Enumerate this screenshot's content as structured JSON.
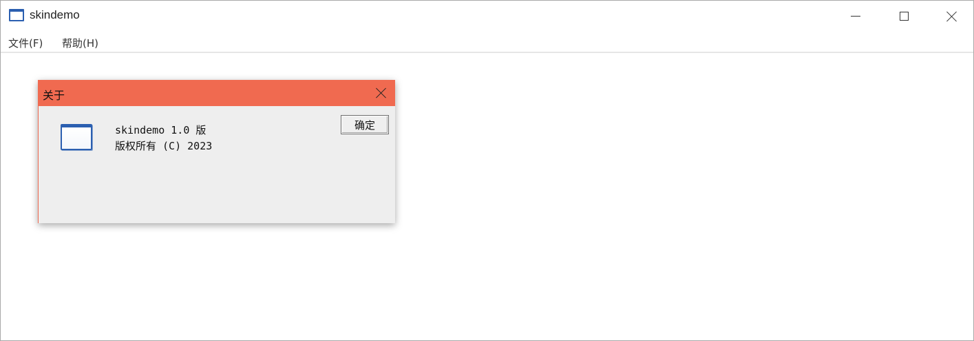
{
  "window": {
    "title": "skindemo",
    "icon": "app-window-icon"
  },
  "menu": {
    "file": "文件(F)",
    "help": "帮助(H)"
  },
  "dialog": {
    "title": "关于",
    "line1": "skindemo 1.0 版",
    "line2": "版权所有 (C) 2023",
    "ok_label": "确定",
    "accent_color": "#f06a50"
  }
}
